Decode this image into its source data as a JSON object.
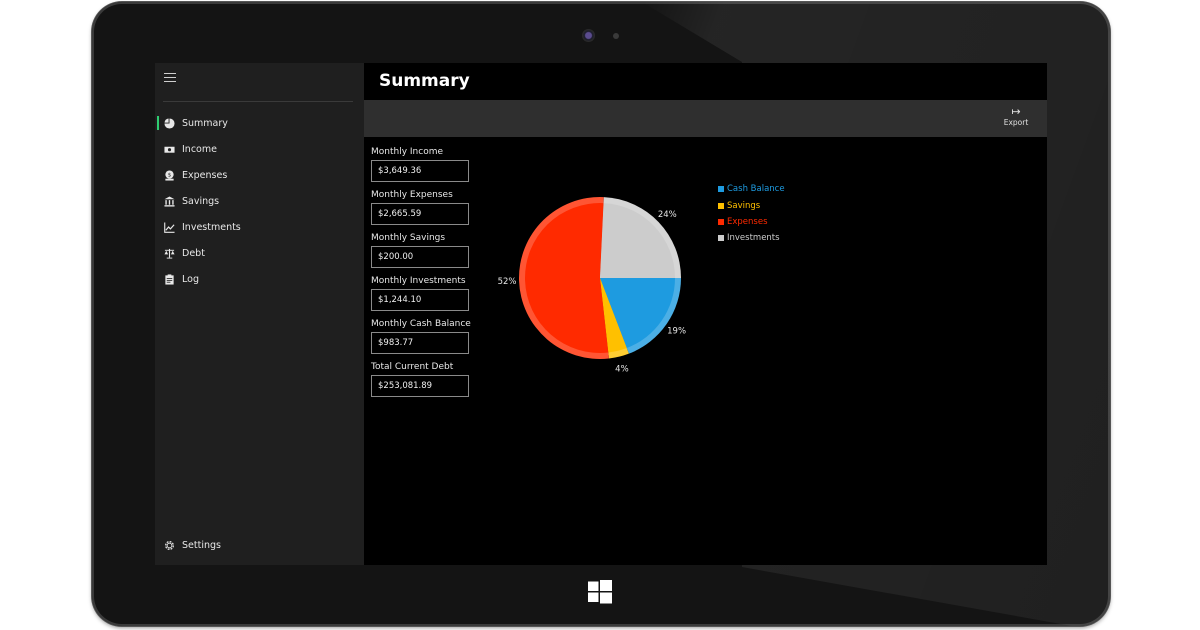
{
  "app": {
    "page_title": "Summary",
    "export_label": "Export"
  },
  "sidebar": {
    "items": [
      {
        "label": "Summary",
        "icon": "pie-chart-icon",
        "active": true
      },
      {
        "label": "Income",
        "icon": "cash-icon"
      },
      {
        "label": "Expenses",
        "icon": "expenses-icon"
      },
      {
        "label": "Savings",
        "icon": "bank-icon"
      },
      {
        "label": "Investments",
        "icon": "line-chart-icon"
      },
      {
        "label": "Debt",
        "icon": "scales-icon"
      },
      {
        "label": "Log",
        "icon": "clipboard-icon"
      }
    ],
    "settings_label": "Settings"
  },
  "fields": [
    {
      "label": "Monthly Income",
      "value": "$3,649.36"
    },
    {
      "label": "Monthly Expenses",
      "value": "$2,665.59"
    },
    {
      "label": "Monthly Savings",
      "value": "$200.00"
    },
    {
      "label": "Monthly Investments",
      "value": "$1,244.10"
    },
    {
      "label": "Monthly Cash Balance",
      "value": "$983.77"
    },
    {
      "label": "Total Current Debt",
      "value": "$253,081.89"
    }
  ],
  "chart_data": {
    "type": "pie",
    "categories": [
      "Cash Balance",
      "Savings",
      "Expenses",
      "Investments"
    ],
    "values": [
      19,
      4,
      52,
      24
    ],
    "data_labels": [
      "19%",
      "4%",
      "52%",
      "24%"
    ],
    "colors": [
      "#1e9be0",
      "#ffc000",
      "#ff2a00",
      "#cccccc"
    ],
    "legend_position": "right"
  }
}
